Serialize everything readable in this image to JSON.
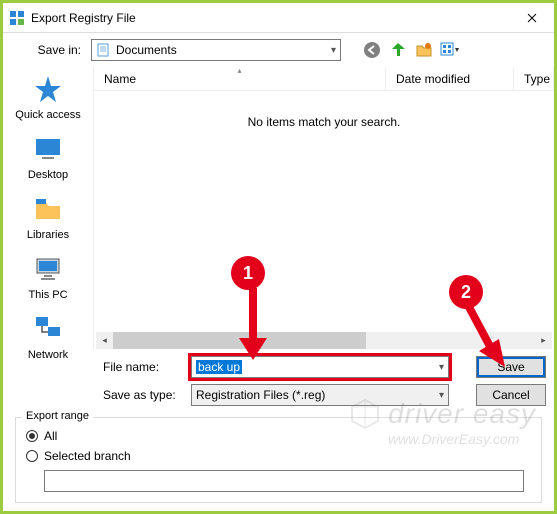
{
  "title": "Export Registry File",
  "toolbar": {
    "save_in_label": "Save in:",
    "location": "Documents"
  },
  "sidebar": {
    "items": [
      {
        "label": "Quick access"
      },
      {
        "label": "Desktop"
      },
      {
        "label": "Libraries"
      },
      {
        "label": "This PC"
      },
      {
        "label": "Network"
      }
    ]
  },
  "columns": {
    "name": "Name",
    "date": "Date modified",
    "type": "Type"
  },
  "empty_message": "No items match your search.",
  "filename": {
    "label": "File name:",
    "value": "back up"
  },
  "filetype": {
    "label": "Save as type:",
    "value": "Registration Files (*.reg)"
  },
  "buttons": {
    "save": "Save",
    "cancel": "Cancel"
  },
  "export_range": {
    "title": "Export range",
    "all": "All",
    "selected_branch": "Selected branch"
  },
  "annotations": {
    "badge1": "1",
    "badge2": "2"
  },
  "watermark": {
    "main": "driver easy",
    "sub": "www.DriverEasy.com"
  }
}
